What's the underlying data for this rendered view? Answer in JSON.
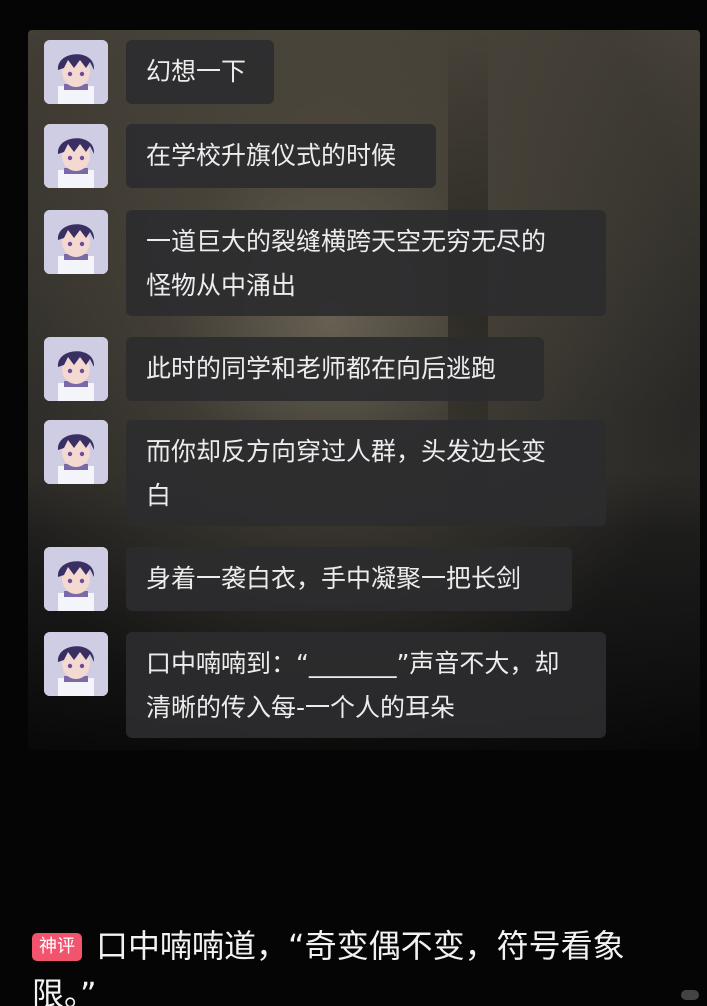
{
  "messages": [
    {
      "lines": [
        "幻想一下"
      ]
    },
    {
      "lines": [
        "在学校升旗仪式的时候"
      ]
    },
    {
      "lines": [
        "一道巨大的裂缝横跨天空无穷无尽的",
        "怪物从中涌出"
      ]
    },
    {
      "lines": [
        "此时的同学和老师都在向后逃跑"
      ]
    },
    {
      "lines": [
        "而你却反方向穿过人群，头发边长变",
        "白"
      ]
    },
    {
      "lines": [
        "身着一袭白衣，手中凝聚一把长剑"
      ]
    },
    {
      "lines": [
        "口中喃喃到：“_______”声音不大，却",
        "清晰的传入每-一个人的耳朵"
      ]
    }
  ],
  "comment": {
    "badge": "神评",
    "line1": "口中喃喃道，“奇变偶不变，符号看象",
    "line2": "限。”"
  },
  "colors": {
    "badge": "#f2546e",
    "bubble": "#2c2c2e",
    "background": "#050505"
  },
  "icons": {
    "avatar": "anime-boy-avatar-icon"
  }
}
